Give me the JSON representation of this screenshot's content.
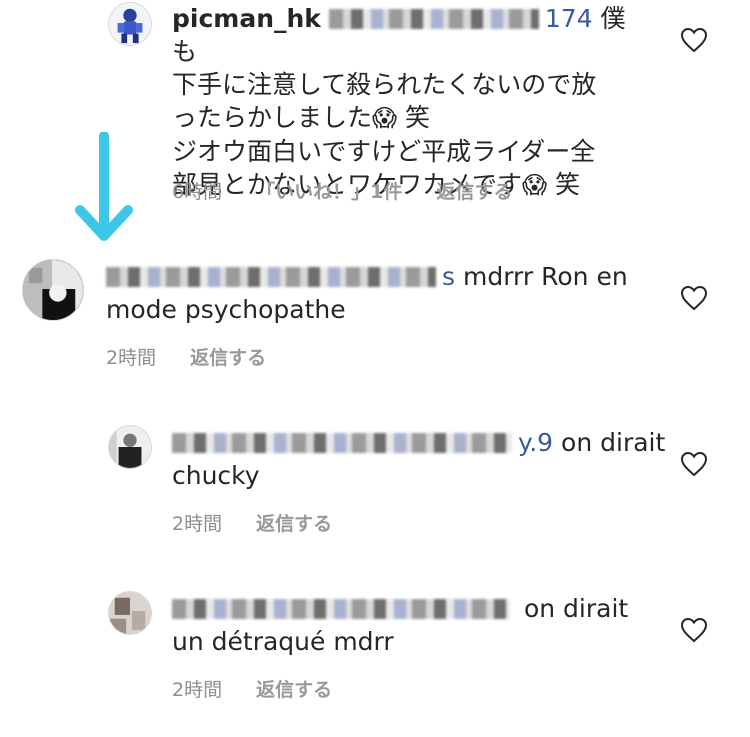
{
  "comments": [
    {
      "username": "picman_hk",
      "mention_suffix": "174",
      "line1_tail": " 僕も",
      "line2": "下手に注意して殺られたくないので放",
      "line3": "ったらかしました",
      "line3_tail": " 笑",
      "line4": "ジオウ面白いですけど平成ライダー全",
      "line5": "部見とかないとワケワカメです",
      "line5_tail": " 笑",
      "emoji": "😱",
      "time": "6時間",
      "likes": "「いいね！」1件",
      "reply": "返信する"
    },
    {
      "username_tail": "s",
      "text_line1": " mdrrr Ron en",
      "text_line2": "mode psychopathe",
      "time": "2時間",
      "reply": "返信する"
    },
    {
      "username_tail": "y.9",
      "text_line1": " on dirait",
      "text_line2": "chucky",
      "time": "2時間",
      "reply": "返信する"
    },
    {
      "text_line1": " on dirait",
      "text_line2": "un détraqué mdrr",
      "time": "2時間",
      "reply": "返信する"
    }
  ],
  "colors": {
    "arrow": "#3ec6ea",
    "meta_text": "#8e8e8e",
    "body_text": "#262626",
    "heart_outline": "#262626"
  },
  "icons": {
    "heart": "heart-outline-icon",
    "arrow": "arrow-down-icon"
  }
}
